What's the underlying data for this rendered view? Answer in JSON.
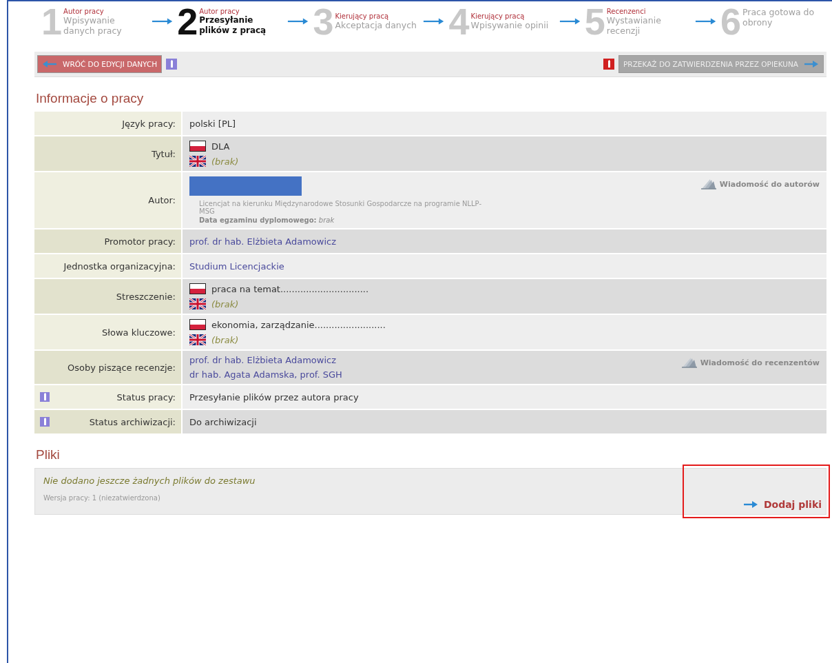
{
  "steps": [
    {
      "number": "1",
      "role": "Autor pracy",
      "label": "Wpisywanie danych pracy",
      "selected": false
    },
    {
      "number": "2",
      "role": "Autor pracy",
      "label": "Przesyłanie plików z pracą",
      "selected": true
    },
    {
      "number": "3",
      "role": "Kierujący pracą",
      "label": "Akceptacja danych",
      "selected": false
    },
    {
      "number": "4",
      "role": "Kierujący pracą",
      "label": "Wpisywanie opinii",
      "selected": false
    },
    {
      "number": "5",
      "role": "Recenzenci",
      "label": "Wystawianie recenzji",
      "selected": false
    },
    {
      "number": "6",
      "label": "Praca gotowa do obrony",
      "selected": false
    }
  ],
  "toolbar": {
    "back_button": "WRÓĆ DO EDYCJI DANYCH",
    "forward_button": "PRZEKAŻ DO ZATWIERDZENIA PRZEZ OPIEKUNA"
  },
  "info": {
    "heading": "Informacje o pracy",
    "rows": [
      {
        "kind": "text",
        "label": "Język pracy:",
        "value": "polski [PL]"
      },
      {
        "kind": "langs",
        "label": "Tytuł:",
        "entries": [
          {
            "kind": "pl",
            "text": "DLA",
            "missing": false
          },
          {
            "kind": "gb",
            "text": "(brak)",
            "missing": true
          }
        ]
      },
      {
        "kind": "author",
        "label": "Autor:",
        "redacted": true,
        "programme": "Licencjat na kierunku Międzynarodowe Stosunki Gospodarcze na programie NLLP-MSG",
        "exam": "**Data egzaminu dyplomowego:** *brak*",
        "message": "Wiadomość do autorów"
      },
      {
        "kind": "links",
        "label": "Promotor pracy:",
        "links": [
          "prof. dr hab. Elżbieta Adamowicz"
        ]
      },
      {
        "kind": "links",
        "label": "Jednostka organizacyjna:",
        "links": [
          "Studium Licencjackie"
        ]
      },
      {
        "kind": "langs",
        "label": "Streszczenie:",
        "entries": [
          {
            "kind": "pl",
            "text": "praca na temat...............................",
            "missing": false
          },
          {
            "kind": "gb",
            "text": "(brak)",
            "missing": true
          }
        ]
      },
      {
        "kind": "langs",
        "label": "Słowa kluczowe:",
        "entries": [
          {
            "kind": "pl",
            "text": "ekonomia, zarządzanie.........................",
            "missing": false
          },
          {
            "kind": "gb",
            "text": "(brak)",
            "missing": true
          }
        ]
      },
      {
        "kind": "links",
        "label": "Osoby piszące recenzje:",
        "links": [
          "prof. dr hab. Elżbieta Adamowicz",
          "dr hab. Agata Adamska, prof. SGH"
        ],
        "message": "Wiadomość do recenzentów"
      },
      {
        "kind": "text",
        "label": "Status pracy:",
        "value": "Przesyłanie plików przez autora pracy",
        "info": true
      },
      {
        "kind": "text",
        "label": "Status archiwizacji:",
        "value": "Do archiwizacji",
        "info": true
      }
    ]
  },
  "files": {
    "heading": "Pliki",
    "empty_message": "Nie dodano jeszcze żadnych plików do zestawu",
    "version": "Wersja pracy: 1 (niezatwierdzona)",
    "add_button": "Dodaj pliki",
    "highlighted": true
  }
}
